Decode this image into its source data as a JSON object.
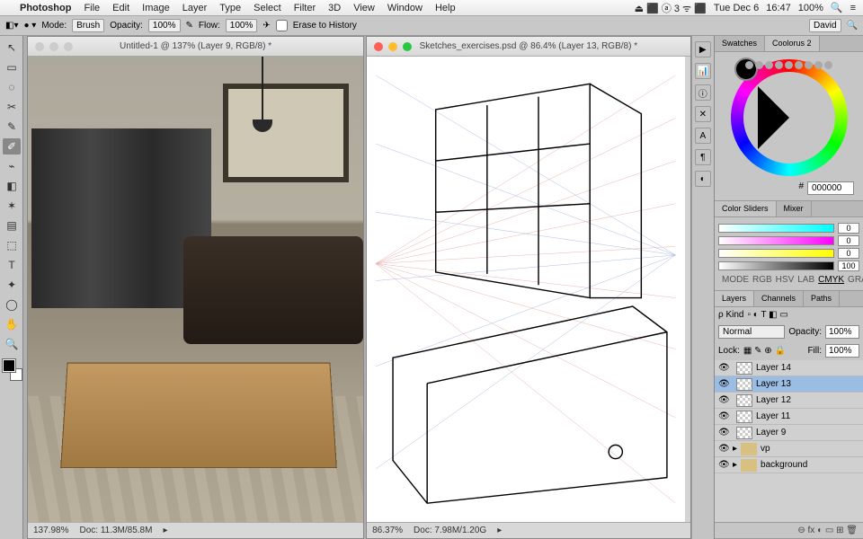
{
  "menubar": {
    "app": "Photoshop",
    "items": [
      "File",
      "Edit",
      "Image",
      "Layer",
      "Type",
      "Select",
      "Filter",
      "3D",
      "View",
      "Window",
      "Help"
    ],
    "right": {
      "icons": "⏏ ⬛ ⓐ 3 ᯤ ⬛",
      "date": "Tue Dec 6",
      "time": "16:47",
      "battery": "100%",
      "search": "🔍",
      "menu": "≡"
    }
  },
  "optionsbar": {
    "mode_label": "Mode:",
    "mode_value": "Brush",
    "opacity_label": "Opacity:",
    "opacity_value": "100%",
    "flow_label": "Flow:",
    "flow_value": "100%",
    "erase_label": "Erase to History",
    "workspace": "David"
  },
  "toolbox": {
    "tools": [
      "↖",
      "▭",
      "◌",
      "✂",
      "✎",
      "✐",
      "⌁",
      "◧",
      "✶",
      "▤",
      "⬚",
      "T",
      "✦",
      "◯",
      "✋",
      "🔍"
    ],
    "selected_index": 5
  },
  "doc1": {
    "title": "Untitled-1 @ 137% (Layer 9, RGB/8) *",
    "zoom": "137.98%",
    "docinfo": "Doc: 11.3M/85.8M"
  },
  "doc2": {
    "title": "Sketches_exercises.psd @ 86.4% (Layer 13, RGB/8) *",
    "zoom": "86.37%",
    "docinfo": "Doc: 7.98M/1.20G"
  },
  "swatches_panel": {
    "tab1": "Swatches",
    "tab2": "Coolorus 2",
    "hex_label": "#",
    "hex_value": "000000"
  },
  "sliders_panel": {
    "tab1": "Color Sliders",
    "tab2": "Mixer",
    "vals": [
      "0",
      "0",
      "0",
      "100"
    ],
    "modes": [
      "MODE",
      "RGB",
      "HSV",
      "LAB",
      "CMYK",
      "GRAYSCALE"
    ],
    "active_mode": "CMYK"
  },
  "layers_panel": {
    "tabs": [
      "Layers",
      "Channels",
      "Paths"
    ],
    "kind_label": "ρ Kind",
    "blend": "Normal",
    "opacity_label": "Opacity:",
    "opacity_value": "100%",
    "lock_label": "Lock:",
    "fill_label": "Fill:",
    "fill_value": "100%",
    "layers": [
      {
        "name": "Layer 14",
        "vis": true
      },
      {
        "name": "Layer 13",
        "vis": true,
        "sel": true
      },
      {
        "name": "Layer 12",
        "vis": true
      },
      {
        "name": "Layer 11",
        "vis": true
      },
      {
        "name": "Layer 9",
        "vis": true
      },
      {
        "name": "vp",
        "vis": true,
        "folder": true
      },
      {
        "name": "background",
        "vis": true,
        "folder": true
      }
    ],
    "footer_icons": "⊖  fx ◐ ▭ ⊞ 🗑"
  }
}
